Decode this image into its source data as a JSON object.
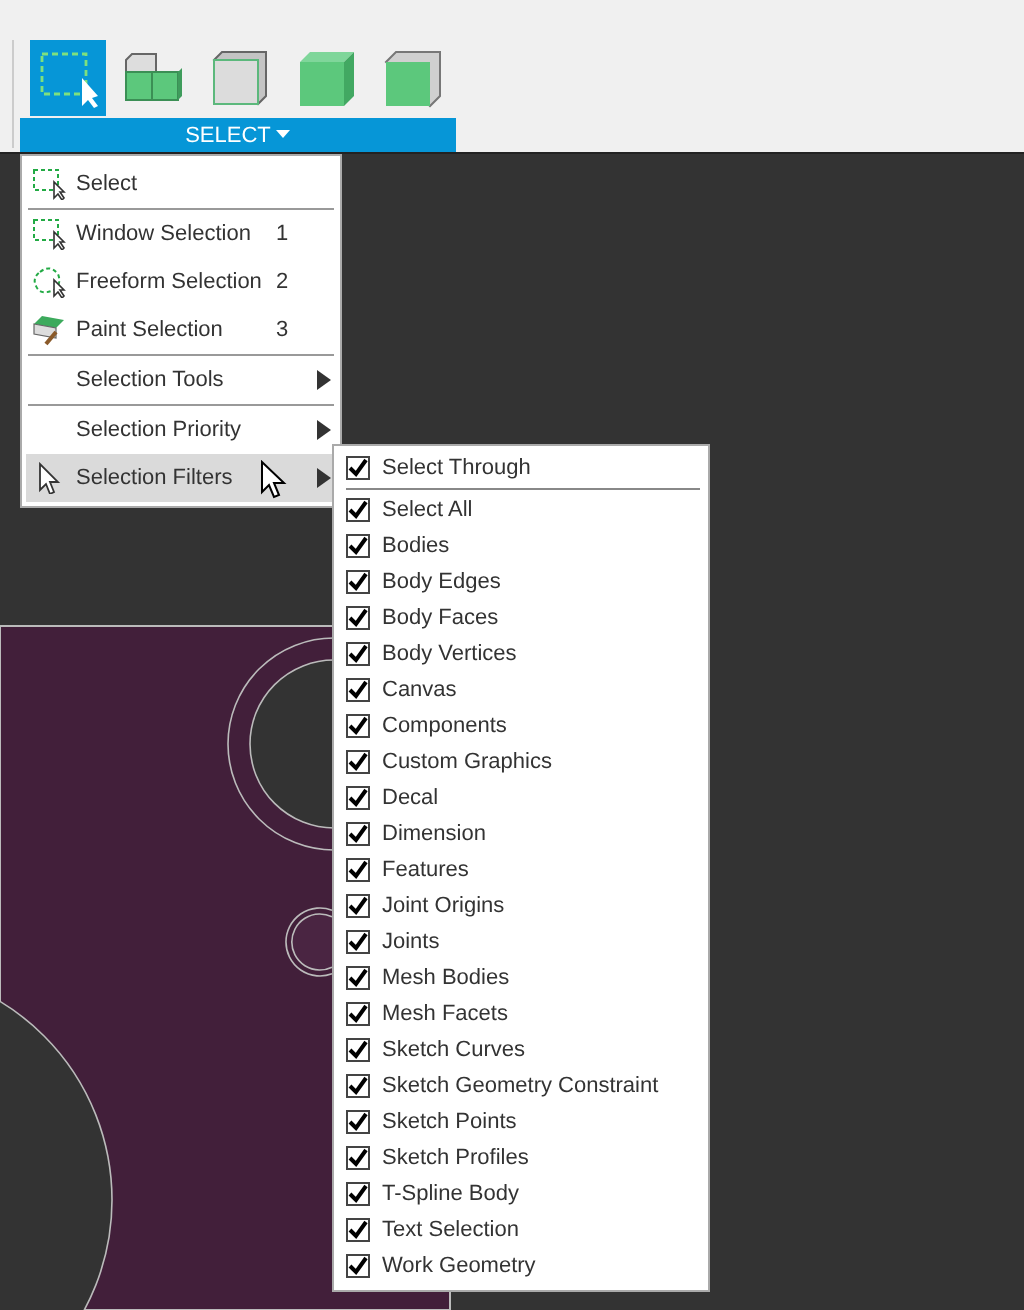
{
  "toolbar": {
    "tools": [
      {
        "kind": "window-select",
        "selected": true
      },
      {
        "kind": "cube-stack",
        "selected": false
      },
      {
        "kind": "cube-grey",
        "selected": false
      },
      {
        "kind": "cube-green",
        "selected": false
      },
      {
        "kind": "cube-face",
        "selected": false
      }
    ],
    "panel_button": {
      "label": "SELECT"
    }
  },
  "select_menu": {
    "items": [
      {
        "kind": "command",
        "label": "Select",
        "selected": false
      },
      {
        "kind": "separator"
      },
      {
        "kind": "command",
        "label": "Window Selection",
        "shortcut": "1",
        "selected": false
      },
      {
        "kind": "command",
        "label": "Freeform Selection",
        "shortcut": "2",
        "selected": false
      },
      {
        "kind": "command",
        "label": "Paint Selection",
        "shortcut": "3",
        "selected": false
      },
      {
        "kind": "separator"
      },
      {
        "kind": "submenu",
        "label": "Selection Tools",
        "selected": false
      },
      {
        "kind": "separator"
      },
      {
        "kind": "submenu",
        "label": "Selection Priority",
        "selected": false
      },
      {
        "kind": "submenu",
        "label": "Selection Filters",
        "selected": true
      }
    ]
  },
  "filters_menu": {
    "header": {
      "label": "Select Through",
      "checked": true
    },
    "items": [
      {
        "label": "Select All",
        "checked": true
      },
      {
        "label": "Bodies",
        "checked": true
      },
      {
        "label": "Body Edges",
        "checked": true
      },
      {
        "label": "Body Faces",
        "checked": true
      },
      {
        "label": "Body Vertices",
        "checked": true
      },
      {
        "label": "Canvas",
        "checked": true
      },
      {
        "label": "Components",
        "checked": true
      },
      {
        "label": "Custom Graphics",
        "checked": true
      },
      {
        "label": "Decal",
        "checked": true
      },
      {
        "label": "Dimension",
        "checked": true
      },
      {
        "label": "Features",
        "checked": true
      },
      {
        "label": "Joint Origins",
        "checked": true
      },
      {
        "label": "Joints",
        "checked": true
      },
      {
        "label": "Mesh Bodies",
        "checked": true
      },
      {
        "label": "Mesh Facets",
        "checked": true
      },
      {
        "label": "Sketch Curves",
        "checked": true
      },
      {
        "label": "Sketch Geometry Constraint",
        "checked": true
      },
      {
        "label": "Sketch Points",
        "checked": true
      },
      {
        "label": "Sketch Profiles",
        "checked": true
      },
      {
        "label": "T-Spline Body",
        "checked": true
      },
      {
        "label": "Text Selection",
        "checked": true
      },
      {
        "label": "Work Geometry",
        "checked": true
      }
    ]
  }
}
